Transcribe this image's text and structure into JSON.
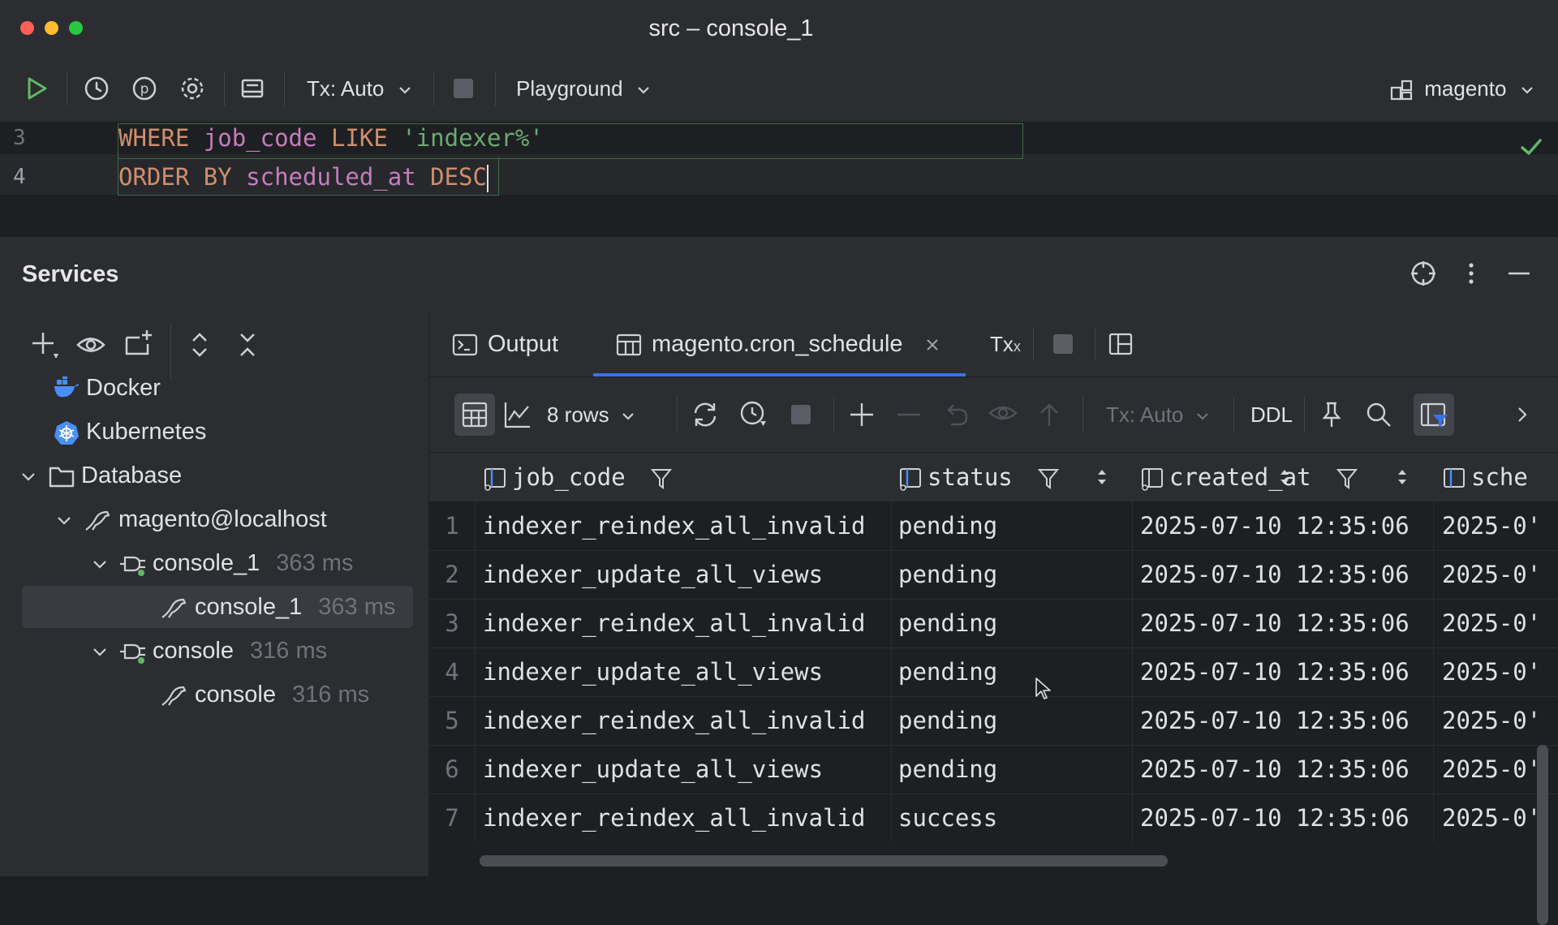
{
  "window": {
    "title": "src – console_1"
  },
  "toolbar": {
    "tx_mode": "Tx: Auto",
    "playground": "Playground",
    "datasource": "magento"
  },
  "editor": {
    "lines": [
      {
        "num": "3",
        "tokens": [
          "WHERE",
          "job_code",
          "LIKE",
          "'indexer%'"
        ]
      },
      {
        "num": "4",
        "tokens": [
          "ORDER BY",
          "scheduled_at",
          "DESC"
        ]
      }
    ]
  },
  "services": {
    "title": "Services",
    "tree": {
      "docker": "Docker",
      "kubernetes": "Kubernetes",
      "database": "Database",
      "host": "magento@localhost",
      "console1_group": "console_1",
      "console1_group_time": "363 ms",
      "console1_item": "console_1",
      "console1_item_time": "363 ms",
      "console_group": "console",
      "console_group_time": "316 ms",
      "console_item": "console",
      "console_item_time": "316 ms"
    }
  },
  "results": {
    "tabs": {
      "output": "Output",
      "table": "magento.cron_schedule",
      "tx": "Tx"
    },
    "toolbar": {
      "rows": "8 rows",
      "tx_mode": "Tx: Auto",
      "ddl": "DDL"
    },
    "columns": [
      "job_code",
      "status",
      "created_at",
      "sche"
    ],
    "rows": [
      {
        "n": "1",
        "job_code": "indexer_reindex_all_invalid",
        "status": "pending",
        "created_at": "2025-07-10 12:35:06",
        "sched": "2025-0'"
      },
      {
        "n": "2",
        "job_code": "indexer_update_all_views",
        "status": "pending",
        "created_at": "2025-07-10 12:35:06",
        "sched": "2025-0'"
      },
      {
        "n": "3",
        "job_code": "indexer_reindex_all_invalid",
        "status": "pending",
        "created_at": "2025-07-10 12:35:06",
        "sched": "2025-0'"
      },
      {
        "n": "4",
        "job_code": "indexer_update_all_views",
        "status": "pending",
        "created_at": "2025-07-10 12:35:06",
        "sched": "2025-0'"
      },
      {
        "n": "5",
        "job_code": "indexer_reindex_all_invalid",
        "status": "pending",
        "created_at": "2025-07-10 12:35:06",
        "sched": "2025-0'"
      },
      {
        "n": "6",
        "job_code": "indexer_update_all_views",
        "status": "pending",
        "created_at": "2025-07-10 12:35:06",
        "sched": "2025-0'"
      },
      {
        "n": "7",
        "job_code": "indexer_reindex_all_invalid",
        "status": "success",
        "created_at": "2025-07-10 12:35:06",
        "sched": "2025-0'"
      }
    ]
  },
  "colors": {
    "accent": "#3574f0",
    "run_green": "#5fb865",
    "check_green": "#5fb865",
    "keyword": "#cf8e6d",
    "identifier": "#c77dbb",
    "string": "#6aab73"
  }
}
